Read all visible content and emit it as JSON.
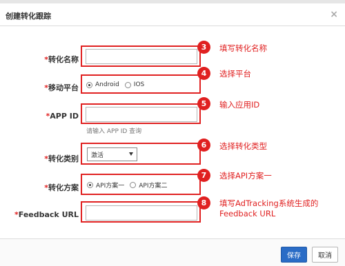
{
  "dialog": {
    "title": "创建转化跟踪",
    "close_glyph": "×"
  },
  "form": {
    "name": {
      "label": "转化名称",
      "value": ""
    },
    "platform": {
      "label": "移动平台",
      "options": [
        "Android",
        "IOS"
      ],
      "selected": "Android"
    },
    "app_id": {
      "label": "APP ID",
      "value": "",
      "hint": "请输入 APP ID 查询"
    },
    "category": {
      "label": "转化类别",
      "selected": "激活"
    },
    "scheme": {
      "label": "转化方案",
      "options": [
        "API方案一",
        "API方案二"
      ],
      "selected": "API方案一"
    },
    "feedback_url": {
      "label": "Feedback URL",
      "value": ""
    }
  },
  "annotations": [
    {
      "number": "3",
      "text": "填写转化名称"
    },
    {
      "number": "4",
      "text": "选择平台"
    },
    {
      "number": "5",
      "text": "输入应用ID"
    },
    {
      "number": "6",
      "text": "选择转化类型"
    },
    {
      "number": "7",
      "text": "选择API方案一"
    },
    {
      "number": "8",
      "text": "填写AdTracking系统生成的",
      "text2": "Feedback URL"
    }
  ],
  "footer": {
    "save_label": "保存",
    "cancel_label": "取消"
  },
  "colors": {
    "accent": "#e02020",
    "primary_button": "#2a6cc6"
  }
}
